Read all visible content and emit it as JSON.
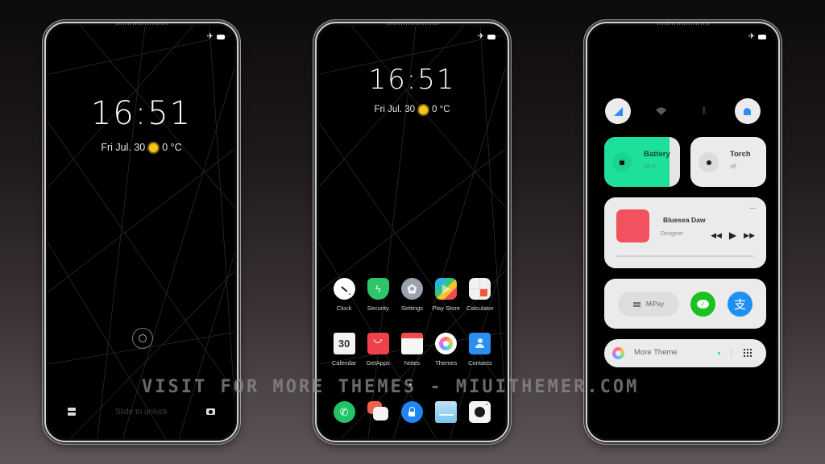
{
  "phones": {
    "lockscreen": {
      "time": "16:51",
      "date": "Fri Jul. 30",
      "weather_temp": "0 °C",
      "weather_icon": "sun-icon",
      "slide_hint": "Slide to unlock",
      "status_icons": [
        "airplane-icon",
        "battery-icon"
      ]
    },
    "homescreen": {
      "time": "16:51",
      "date": "Fri Jul. 30",
      "weather_temp": "0 °C",
      "apps_row1": [
        {
          "label": "Clock",
          "icon": "clock-icon"
        },
        {
          "label": "Security",
          "icon": "shield-bolt-icon"
        },
        {
          "label": "Settings",
          "icon": "gear-icon"
        },
        {
          "label": "Play Store",
          "icon": "play-store-icon"
        },
        {
          "label": "Calculator",
          "icon": "calculator-icon"
        }
      ],
      "apps_row2": [
        {
          "label": "Calendar",
          "icon": "calendar-icon",
          "badge": "30"
        },
        {
          "label": "GetApps",
          "icon": "shopping-bag-icon"
        },
        {
          "label": "Notes",
          "icon": "notes-icon"
        },
        {
          "label": "Themes",
          "icon": "themes-icon"
        },
        {
          "label": "Contacts",
          "icon": "contacts-icon"
        }
      ],
      "dock": [
        {
          "icon": "phone-icon"
        },
        {
          "icon": "messages-icon"
        },
        {
          "icon": "app-lock-icon"
        },
        {
          "icon": "gallery-icon"
        },
        {
          "icon": "camera-icon"
        }
      ]
    },
    "control_center": {
      "toggles": [
        "mobile-data-icon",
        "wifi-icon",
        "bluetooth-icon",
        "notification-bell-icon"
      ],
      "battery": {
        "label": "Battery",
        "value": "86 %",
        "level": 0.86
      },
      "torch": {
        "label": "Torch",
        "state": "off"
      },
      "music": {
        "title": "Bluesea Daw",
        "artist": "Designer",
        "menu": "···",
        "progress": 0.0
      },
      "pay": {
        "mipay_label": "MiPay",
        "wechat": "wechat-pay-icon",
        "alipay": "alipay-icon"
      },
      "more_theme": {
        "label": "More Theme"
      }
    }
  },
  "watermark": "VISIT FOR MORE THEMES - MIUITHEMER.COM",
  "colors": {
    "battery_green": "#1de09a",
    "accent_blue": "#2f8ef5",
    "album_red": "#f2525f",
    "wechat_green": "#19c21d",
    "alipay_blue": "#1f8ff0"
  }
}
